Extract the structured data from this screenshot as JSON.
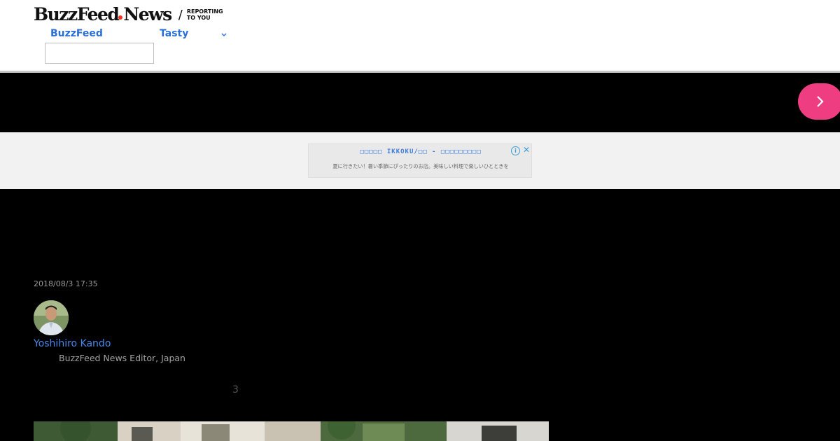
{
  "header": {
    "logo_brand": "BuzzFeed",
    "logo_news": "News",
    "logo_slash": "/",
    "logo_tagline_line1": "REPORTING",
    "logo_tagline_line2": "TO YOU",
    "nav": {
      "buzzfeed_label": "BuzzFeed",
      "tasty_label": "Tasty"
    },
    "search_value": ""
  },
  "colors": {
    "accent_pink": "#ee3d80",
    "link_blue": "#2a6fd6",
    "ad_blue": "#3a7be0"
  },
  "ad": {
    "title": "□□□□□ IKKOKU/□□ - □□□□□□□□□",
    "description": "夏に行きたい！暑い季節にぴったりのお店。美味しい料理で楽しいひとときを"
  },
  "article": {
    "timestamp": "2018/08/3 17:35",
    "author_name": "Yoshihiro Kando",
    "author_role": "BuzzFeed News Editor, Japan",
    "marker": "3"
  }
}
